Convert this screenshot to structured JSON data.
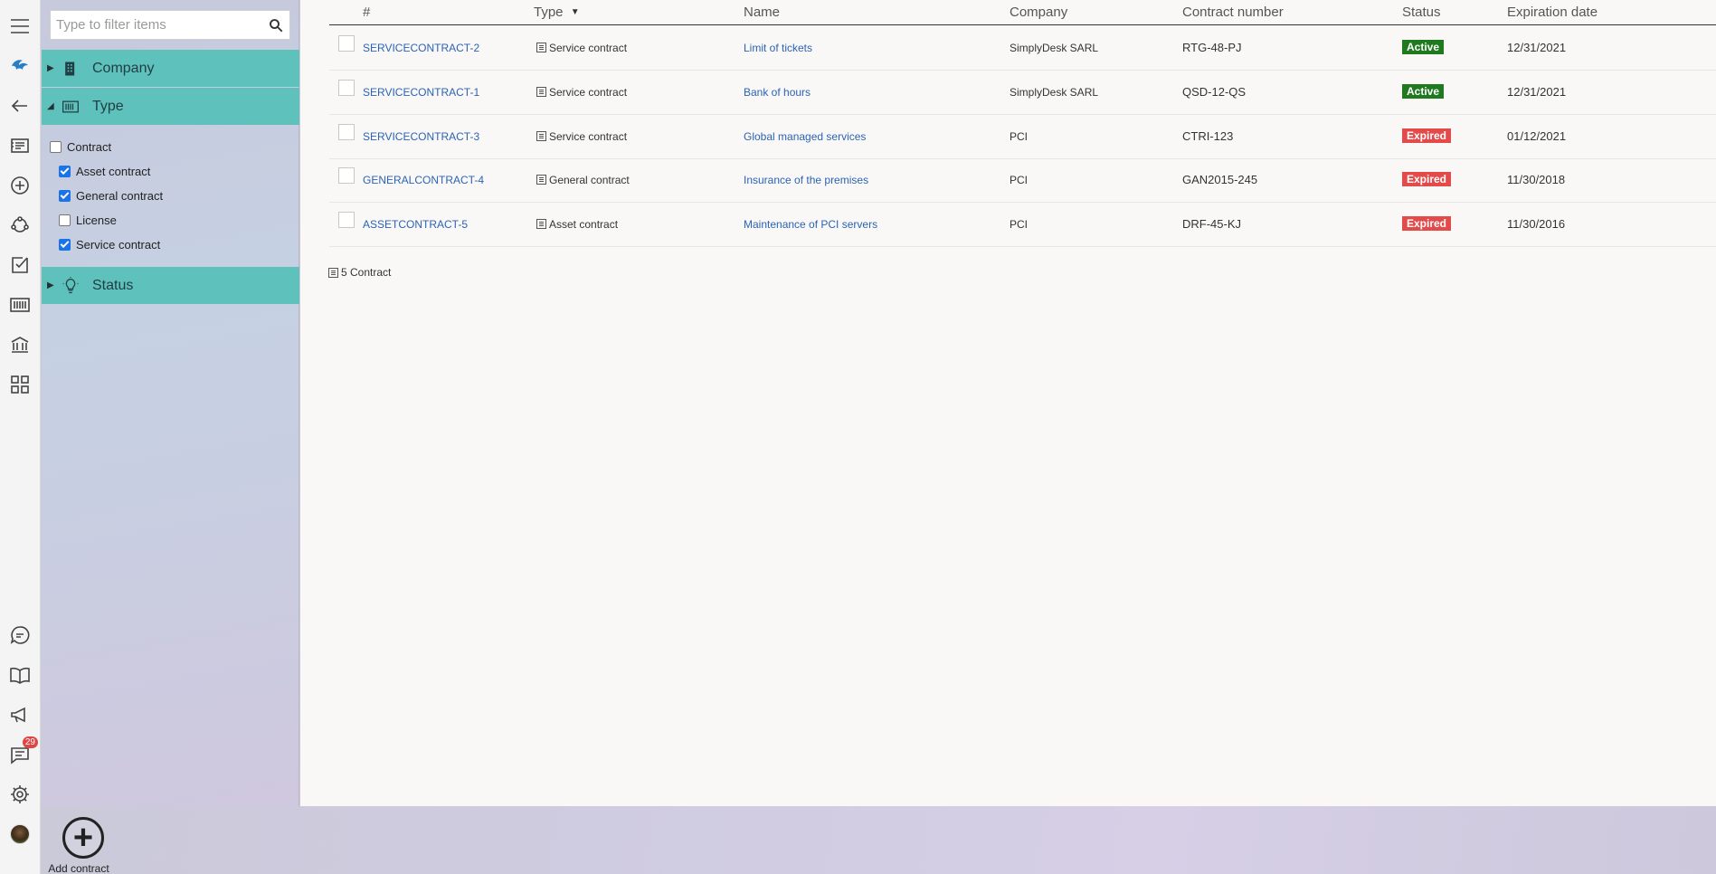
{
  "filter": {
    "placeholder": "Type to filter items"
  },
  "sections": {
    "company": "Company",
    "type": "Type",
    "status": "Status"
  },
  "type_filters": [
    {
      "label": "Contract",
      "checked": false
    },
    {
      "label": "Asset contract",
      "checked": true
    },
    {
      "label": "General contract",
      "checked": true
    },
    {
      "label": "License",
      "checked": false
    },
    {
      "label": "Service contract",
      "checked": true
    }
  ],
  "table": {
    "headers": [
      "#",
      "Type",
      "Name",
      "Company",
      "Contract number",
      "Status",
      "Expiration date"
    ],
    "sort_indicator": "▼",
    "rows": [
      {
        "id": "SERVICECONTRACT-2",
        "type": "Service contract",
        "name": "Limit of tickets",
        "company": "SimplyDesk SARL",
        "number": "RTG-48-PJ",
        "status": "Active",
        "expiration": "12/31/2021"
      },
      {
        "id": "SERVICECONTRACT-1",
        "type": "Service contract",
        "name": "Bank of hours",
        "company": "SimplyDesk SARL",
        "number": "QSD-12-QS",
        "status": "Active",
        "expiration": "12/31/2021"
      },
      {
        "id": "SERVICECONTRACT-3",
        "type": "Service contract",
        "name": "Global managed services",
        "company": "PCI",
        "number": "CTRI-123",
        "status": "Expired",
        "expiration": "01/12/2021"
      },
      {
        "id": "GENERALCONTRACT-4",
        "type": "General contract",
        "name": "Insurance of the premises",
        "company": "PCI",
        "number": "GAN2015-245",
        "status": "Expired",
        "expiration": "11/30/2018"
      },
      {
        "id": "ASSETCONTRACT-5",
        "type": "Asset contract",
        "name": "Maintenance of PCI servers",
        "company": "PCI",
        "number": "DRF-45-KJ",
        "status": "Expired",
        "expiration": "11/30/2016"
      }
    ]
  },
  "footer": {
    "count": "5 Contract"
  },
  "add_button": {
    "label": "Add contract"
  },
  "notifications": {
    "count": "29"
  },
  "colors": {
    "accent_teal": "#5fc1bb",
    "active": "#1f7a1f",
    "expired": "#e34a4a",
    "link": "#2b63b5"
  }
}
